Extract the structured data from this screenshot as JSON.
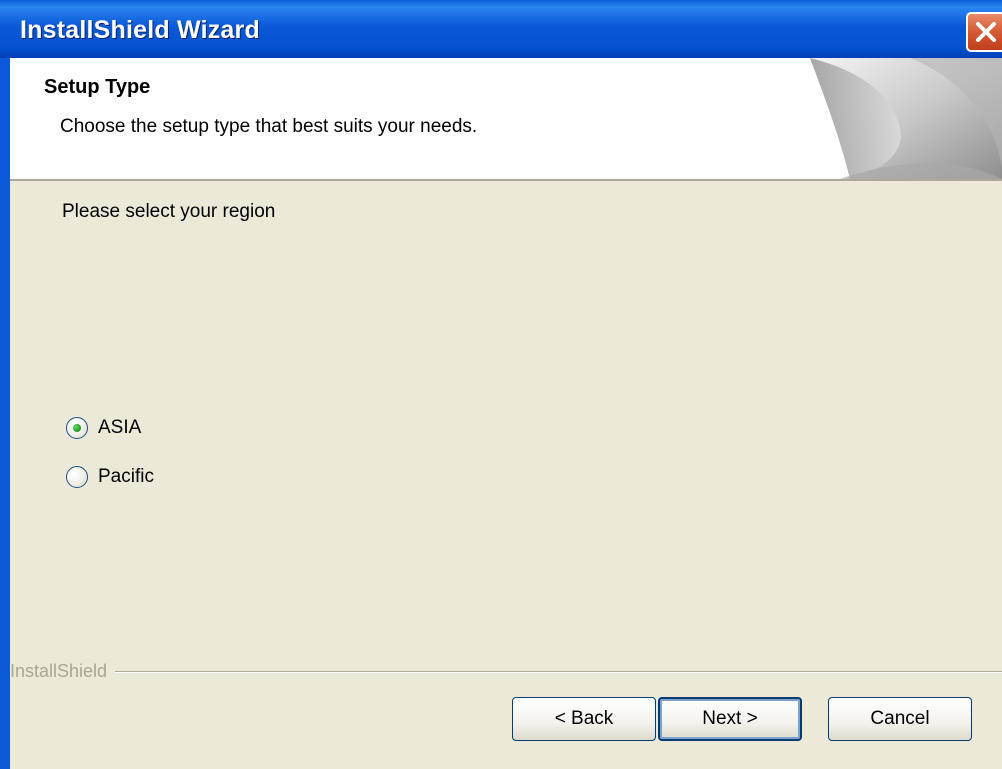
{
  "window": {
    "title": "InstallShield Wizard"
  },
  "header": {
    "title": "Setup Type",
    "description": "Choose the setup type that best suits your needs."
  },
  "content": {
    "prompt": "Please select your region",
    "options": [
      {
        "label": "ASIA",
        "selected": true
      },
      {
        "label": "Pacific",
        "selected": false
      }
    ],
    "brand": "InstallShield"
  },
  "buttons": {
    "back": "< Back",
    "next": "Next >",
    "cancel": "Cancel"
  },
  "colors": {
    "titlebar": "#0553d0",
    "dialog_bg": "#ece9d8",
    "close_button": "#d45a33"
  },
  "icons": {
    "close": "close-icon"
  }
}
